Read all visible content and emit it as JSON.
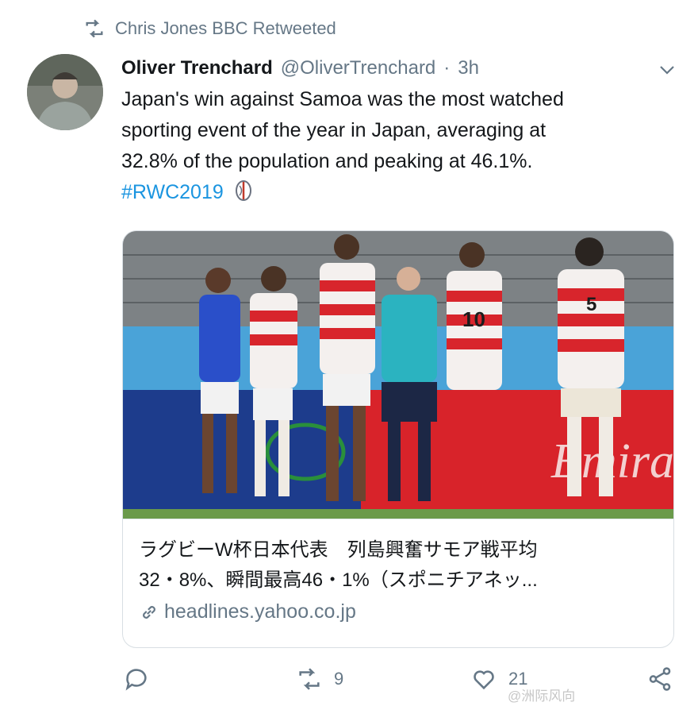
{
  "retweet": {
    "text": "Chris Jones BBC Retweeted",
    "icon": "retweet-icon"
  },
  "author": {
    "name": "Oliver Trenchard",
    "handle": "@OliverTrenchard",
    "separator": "·",
    "time": "3h"
  },
  "tweet": {
    "line1": "Japan's win against Samoa was the most watched",
    "line2": "sporting event of the year in Japan, averaging at",
    "line3": "32.8% of the population and peaking at 46.1%.",
    "hashtag": "#RWC2019"
  },
  "card": {
    "title_line1": "ラグビーW杯日本代表　列島興奮サモア戦平均",
    "title_line2": "32・8%、瞬間最高46・1%（スポニチアネッ...",
    "domain": "headlines.yahoo.co.jp"
  },
  "actions": {
    "reply_count": "",
    "retweet_count": "9",
    "like_count": "21"
  },
  "watermark": "@洲际风向"
}
